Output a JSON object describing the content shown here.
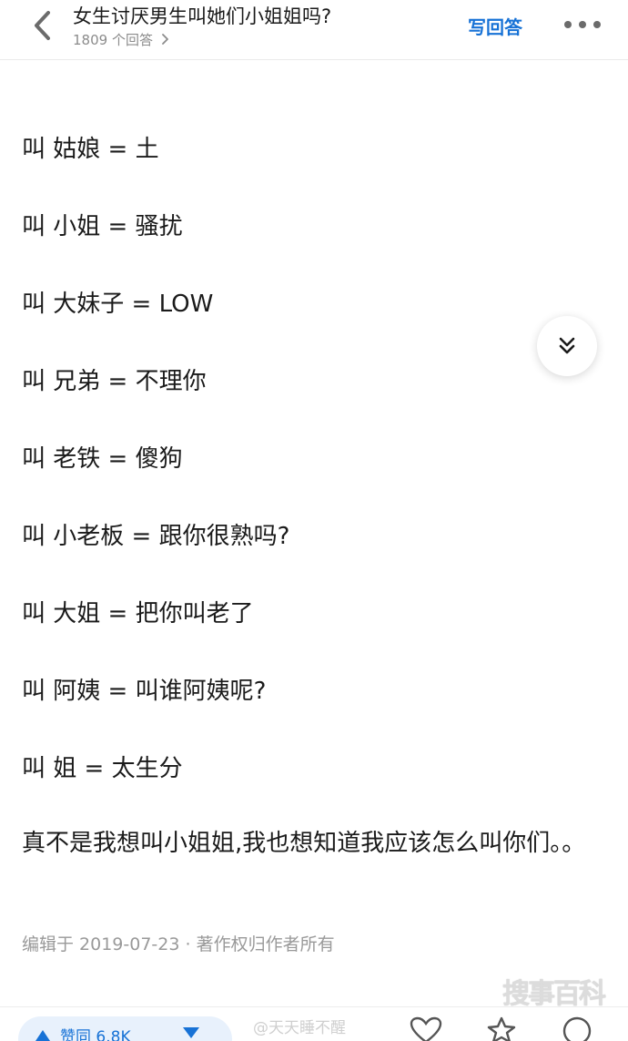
{
  "header": {
    "title": "女生讨厌男生叫她们小姐姐吗?",
    "answers_count": "1809 个回答",
    "write_answer": "写回答",
    "back_icon": "chevron-left-icon",
    "more_icon": "more-dots-icon"
  },
  "answer": {
    "lines": [
      "叫 姑娘 = 土",
      "叫 小姐 = 骚扰",
      "叫 大妹子 = LOW",
      "叫 兄弟 = 不理你",
      "叫 老铁 = 傻狗",
      "叫 小老板 = 跟你很熟吗?",
      "叫 大姐 = 把你叫老了",
      "叫 阿姨 = 叫谁阿姨呢?",
      "叫 姐 = 太生分"
    ],
    "paragraph": "真不是我想叫小姐姐,我也想知道我应该怎么叫你们。。",
    "meta": "编辑于 2019-07-23 · 著作权归作者所有"
  },
  "fab": {
    "icon": "double-chevron-down-icon"
  },
  "bottom_bar": {
    "upvote_label": "赞同 6.8K",
    "weibo_watermark": "@天天睡不醒",
    "icons": [
      "thumb-up-icon",
      "thumb-down-icon",
      "heart-icon",
      "star-icon",
      "comment-icon"
    ]
  },
  "watermark": {
    "brand": "搜事百科"
  },
  "colors": {
    "accent": "#1772d6",
    "text": "#1a1a1a",
    "muted": "#999999",
    "pill_bg": "#e8f1fc"
  }
}
